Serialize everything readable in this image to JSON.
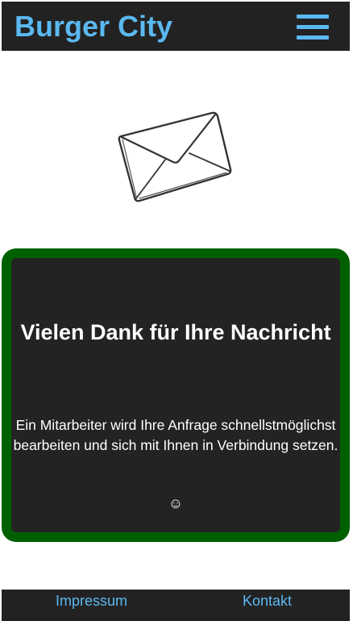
{
  "header": {
    "brand": "Burger City",
    "menu_icon": "hamburger-menu-icon"
  },
  "hero": {
    "image_icon": "envelope-icon"
  },
  "message": {
    "title": "Vielen Dank für Ihre Nachricht",
    "body": "Ein Mitarbeiter wird Ihre Anfrage schnellstmöglichst bearbeiten und sich mit Ihnen in Verbindung setzen.",
    "emoji": "☺"
  },
  "footer": {
    "links": [
      "Impressum",
      "Kontakt"
    ]
  },
  "colors": {
    "accent": "#5bb8f0",
    "bar_background": "#222222",
    "card_border": "#006000",
    "card_background": "#232323"
  }
}
